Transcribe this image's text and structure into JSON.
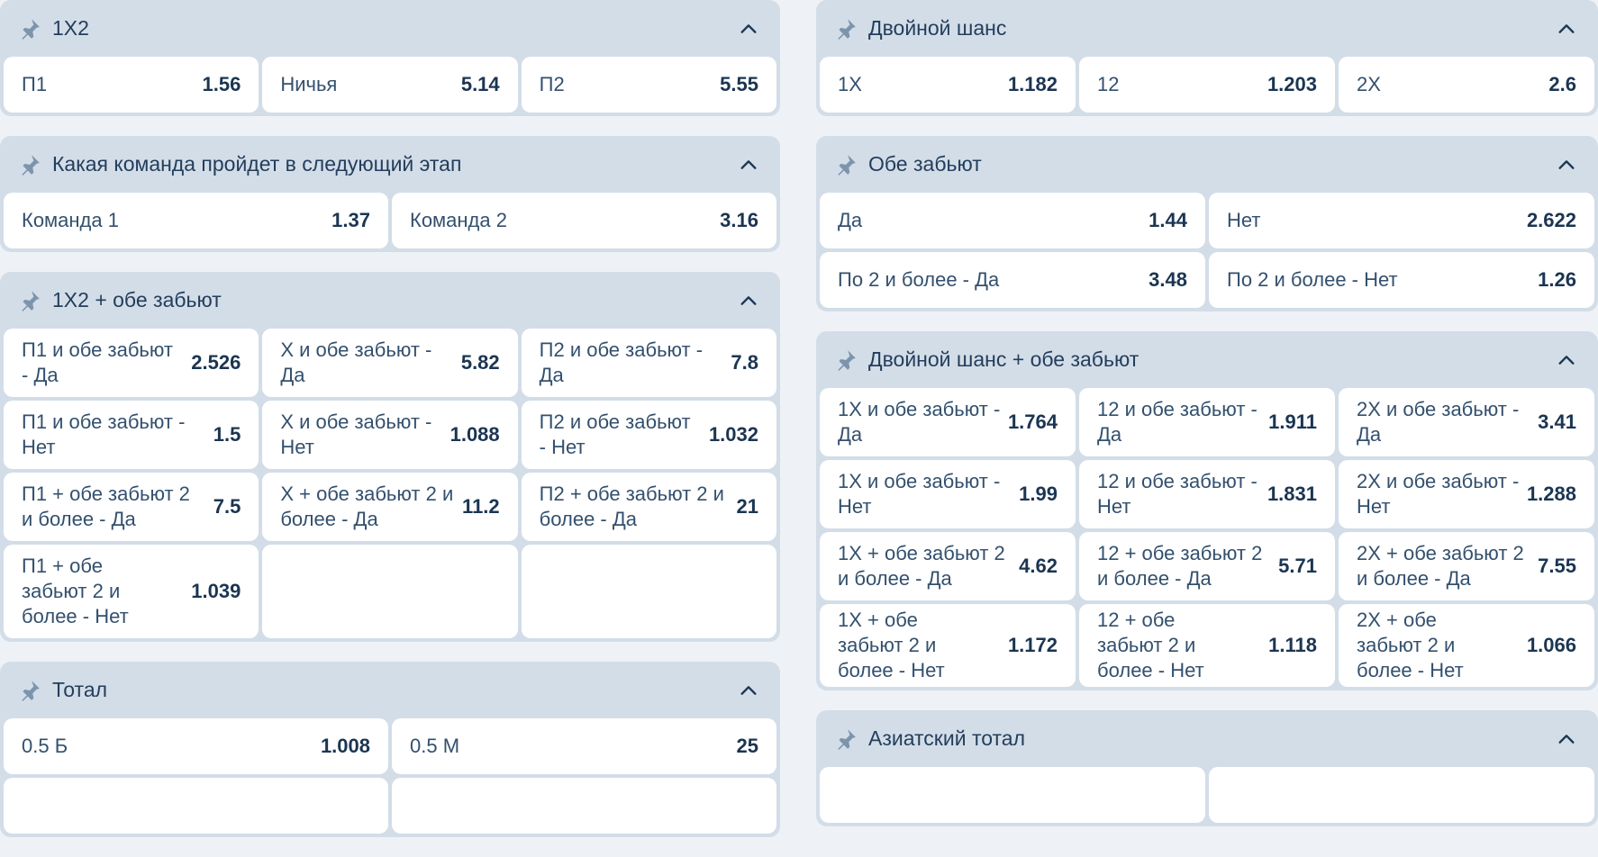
{
  "colors": {
    "background": "#eef2f7",
    "panel": "#d3dde8",
    "cell": "#ffffff",
    "text": "#1b3552"
  },
  "icons": {
    "pin": "pin-icon",
    "collapse": "chevron-up-icon"
  },
  "left": [
    {
      "title": "1X2",
      "outcomes": [
        {
          "label": "П1",
          "odd": "1.56"
        },
        {
          "label": "Ничья",
          "odd": "5.14"
        },
        {
          "label": "П2",
          "odd": "5.55"
        }
      ]
    },
    {
      "title": "Какая команда пройдет в следующий этап",
      "outcomes": [
        {
          "label": "Команда 1",
          "odd": "1.37"
        },
        {
          "label": "Команда 2",
          "odd": "3.16"
        }
      ]
    },
    {
      "title": "1X2 + обе забьют",
      "outcomes": [
        {
          "label": "П1 и обе забьют - Да",
          "odd": "2.526"
        },
        {
          "label": "Х и обе забьют - Да",
          "odd": "5.82"
        },
        {
          "label": "П2 и обе забьют - Да",
          "odd": "7.8"
        },
        {
          "label": "П1 и обе забьют - Нет",
          "odd": "1.5"
        },
        {
          "label": "Х и обе забьют - Нет",
          "odd": "1.088"
        },
        {
          "label": "П2 и обе забьют - Нет",
          "odd": "1.032"
        },
        {
          "label": "П1 + обе забьют 2 и более - Да",
          "odd": "7.5"
        },
        {
          "label": "Х + обе забьют 2 и более - Да",
          "odd": "11.2"
        },
        {
          "label": "П2 + обе забьют 2 и более - Да",
          "odd": "21"
        },
        {
          "label": "П1 + обе забьют 2 и более - Нет",
          "odd": "1.039"
        }
      ]
    },
    {
      "title": "Тотал",
      "outcomes": [
        {
          "label": "0.5 Б",
          "odd": "1.008"
        },
        {
          "label": "0.5 М",
          "odd": "25"
        }
      ]
    }
  ],
  "right": [
    {
      "title": "Двойной шанс",
      "outcomes": [
        {
          "label": "1X",
          "odd": "1.182"
        },
        {
          "label": "12",
          "odd": "1.203"
        },
        {
          "label": "2X",
          "odd": "2.6"
        }
      ]
    },
    {
      "title": "Обе забьют",
      "outcomes": [
        {
          "label": "Да",
          "odd": "1.44"
        },
        {
          "label": "Нет",
          "odd": "2.622"
        },
        {
          "label": "По 2 и более - Да",
          "odd": "3.48"
        },
        {
          "label": "По 2 и более - Нет",
          "odd": "1.26"
        }
      ]
    },
    {
      "title": "Двойной шанс + обе забьют",
      "outcomes": [
        {
          "label": "1X и обе забьют - Да",
          "odd": "1.764"
        },
        {
          "label": "12 и обе забьют - Да",
          "odd": "1.911"
        },
        {
          "label": "2X и обе забьют - Да",
          "odd": "3.41"
        },
        {
          "label": "1X и обе забьют - Нет",
          "odd": "1.99"
        },
        {
          "label": "12 и обе забьют - Нет",
          "odd": "1.831"
        },
        {
          "label": "2X и обе забьют - Нет",
          "odd": "1.288"
        },
        {
          "label": "1X + обе забьют 2 и более - Да",
          "odd": "4.62"
        },
        {
          "label": "12 + обе забьют 2 и более - Да",
          "odd": "5.71"
        },
        {
          "label": "2X + обе забьют 2 и более - Да",
          "odd": "7.55"
        },
        {
          "label": "1X + обе забьют 2 и более - Нет",
          "odd": "1.172"
        },
        {
          "label": "12 + обе забьют 2 и более - Нет",
          "odd": "1.118"
        },
        {
          "label": "2X + обе забьют 2 и более - Нет",
          "odd": "1.066"
        }
      ]
    },
    {
      "title": "Азиатский тотал",
      "outcomes": []
    }
  ]
}
